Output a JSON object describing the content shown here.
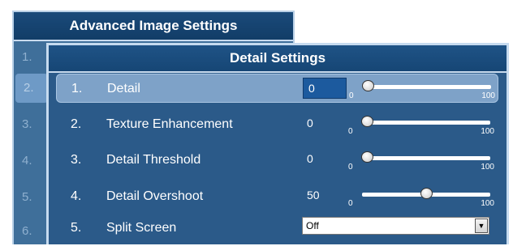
{
  "back_window": {
    "title": "Advanced Image Settings",
    "items": [
      {
        "num": "1."
      },
      {
        "num": "2."
      },
      {
        "num": "3."
      },
      {
        "num": "4."
      },
      {
        "num": "5."
      },
      {
        "num": "6."
      }
    ],
    "selected_index": 1
  },
  "front_window": {
    "title": "Detail Settings",
    "rows": [
      {
        "num": "1.",
        "label": "Detail",
        "value": "0",
        "slider_min": "0",
        "slider_max": "100",
        "level": 0
      },
      {
        "num": "2.",
        "label": "Texture Enhancement",
        "value": "0",
        "slider_min": "0",
        "slider_max": "100",
        "level": 0
      },
      {
        "num": "3.",
        "label": "Detail Threshold",
        "value": "0",
        "slider_min": "0",
        "slider_max": "100",
        "level": 0
      },
      {
        "num": "4.",
        "label": "Detail Overshoot",
        "value": "50",
        "slider_min": "0",
        "slider_max": "100",
        "level": 50
      },
      {
        "num": "5.",
        "label": "Split Screen",
        "dropdown_value": "Off"
      }
    ],
    "selected_index": 0
  },
  "icons": {
    "dropdown_arrow": "chevron-down-icon"
  },
  "colors": {
    "panel_blue": "#2b5a89",
    "header_blue": "#164675",
    "selection": "#7ea2c8",
    "border_light": "#c6dbef"
  }
}
